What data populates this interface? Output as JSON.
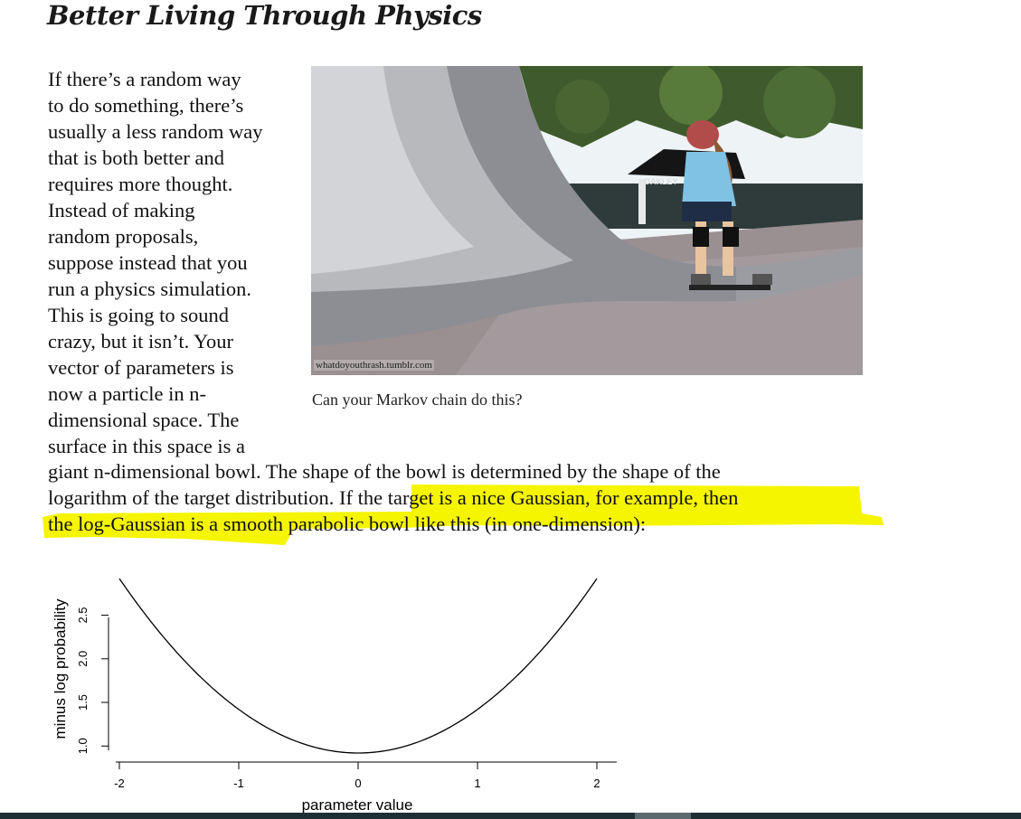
{
  "article": {
    "title": "Better Living Through Physics",
    "narrow_lines": [
      "If there’s a random way",
      "to do something, there’s",
      "usually a less random way",
      "that is both better and",
      "requires more thought.",
      "Instead of making",
      "random proposals,",
      "suppose instead that you",
      "run a physics simulation.",
      "This is going to sound",
      "crazy, but it isn’t. Your",
      "vector of parameters is",
      "now a particle in n-",
      "dimensional space. The",
      "surface in this space is a"
    ],
    "wide_lines": [
      "giant n-dimensional bowl. The shape of the bowl is determined by the shape of the",
      "logarithm of the target distribution. If the target is a nice Gaussian, for example, then",
      "the log-Gaussian is a smooth parabolic bowl like this (in one-dimension):"
    ]
  },
  "figure": {
    "watermark": "whatdoyouthrash.tumblr.com",
    "caption": "Can your Markov chain do this?",
    "tent_text": "OAKLEY"
  },
  "colors": {
    "highlight": "#f5f500",
    "sky": "#eef3f6",
    "ramp": "#8c8d93"
  },
  "chart_data": {
    "type": "line",
    "xlabel": "parameter value",
    "ylabel": "minus log probability",
    "x_ticks": [
      "-2",
      "-1",
      "0",
      "1",
      "2"
    ],
    "y_ticks": [
      "1.0",
      "1.5",
      "2.0",
      "2.5"
    ],
    "xlim": [
      -2,
      2
    ],
    "ylim": [
      0.92,
      2.92
    ],
    "series": [
      {
        "x": [
          -2,
          -1.5,
          -1,
          -0.5,
          0,
          0.5,
          1,
          1.5,
          2
        ],
        "y": [
          2.92,
          2.04,
          1.42,
          1.04,
          0.92,
          1.04,
          1.42,
          2.04,
          2.92
        ]
      }
    ]
  }
}
